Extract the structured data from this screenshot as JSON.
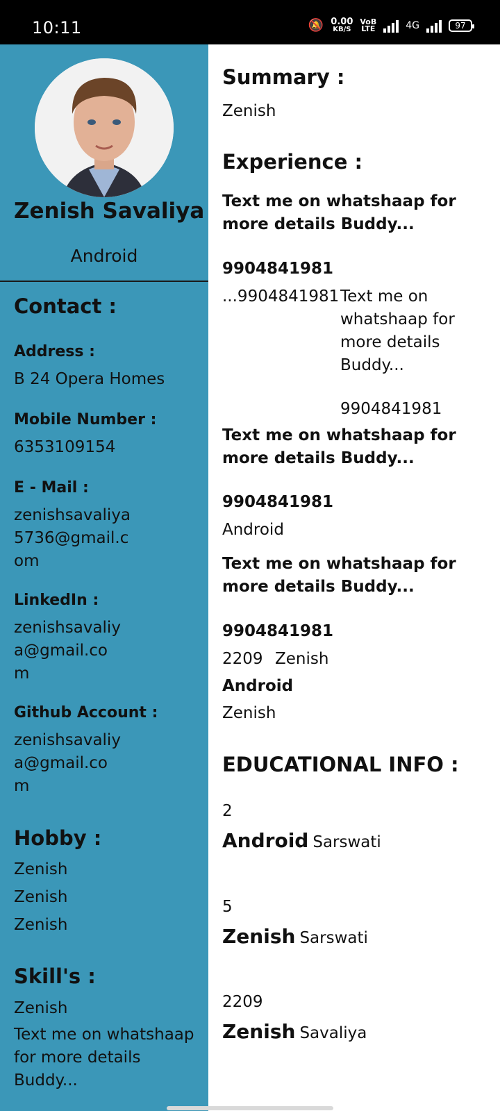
{
  "status_bar": {
    "time": "10:11",
    "speed_value": "0.00",
    "speed_unit": "KB/S",
    "volte_top": "VoB",
    "volte_bottom": "LTE",
    "network": "4G",
    "battery": "97"
  },
  "profile": {
    "name": "Zenish Savaliya",
    "role": "Android"
  },
  "contact": {
    "heading": "Contact :",
    "address_label": "Address :",
    "address_value": "B 24 Opera Homes",
    "mobile_label": "Mobile Number :",
    "mobile_value": "6353109154",
    "email_label": "E - Mail :",
    "email_value": "zenishsavaliya5736@gmail.com",
    "linkedin_label": "LinkedIn :",
    "linkedin_value": "zenishsavaliya@gmail.com",
    "github_label": "Github Account :",
    "github_value": "zenishsavaliya@gmail.com"
  },
  "hobby": {
    "heading": "Hobby :",
    "items": [
      "Zenish",
      "Zenish",
      "Zenish"
    ]
  },
  "skills": {
    "heading": "Skill's :",
    "items": [
      "Zenish",
      "Text me on whatshaap for more details Buddy..."
    ]
  },
  "summary": {
    "heading": "Summary :",
    "text": "Zenish"
  },
  "experience": {
    "heading": "Experience :",
    "entries": [
      {
        "title": "Text me on whatshaap for more details Buddy...",
        "number": "9904841981",
        "left": "...9904841981",
        "right_text": "Text me on whatshaap for more details Buddy...",
        "right_number": "9904841981"
      },
      {
        "title": "Text me on whatshaap for more details Buddy...",
        "number": "9904841981",
        "sub": "Android"
      },
      {
        "title": "Text me on whatshaap for more details Buddy...",
        "number": "9904841981",
        "year": "2209",
        "company": "Zenish",
        "role": "Android",
        "desc": "Zenish"
      }
    ]
  },
  "education": {
    "heading": "EDUCATIONAL INFO :",
    "entries": [
      {
        "year": "2",
        "degree": "Android",
        "school": "Sarswati"
      },
      {
        "year": "5",
        "degree": "Zenish",
        "school": "Sarswati"
      },
      {
        "year": "2209",
        "degree": "Zenish",
        "school": "Savaliya"
      }
    ]
  }
}
